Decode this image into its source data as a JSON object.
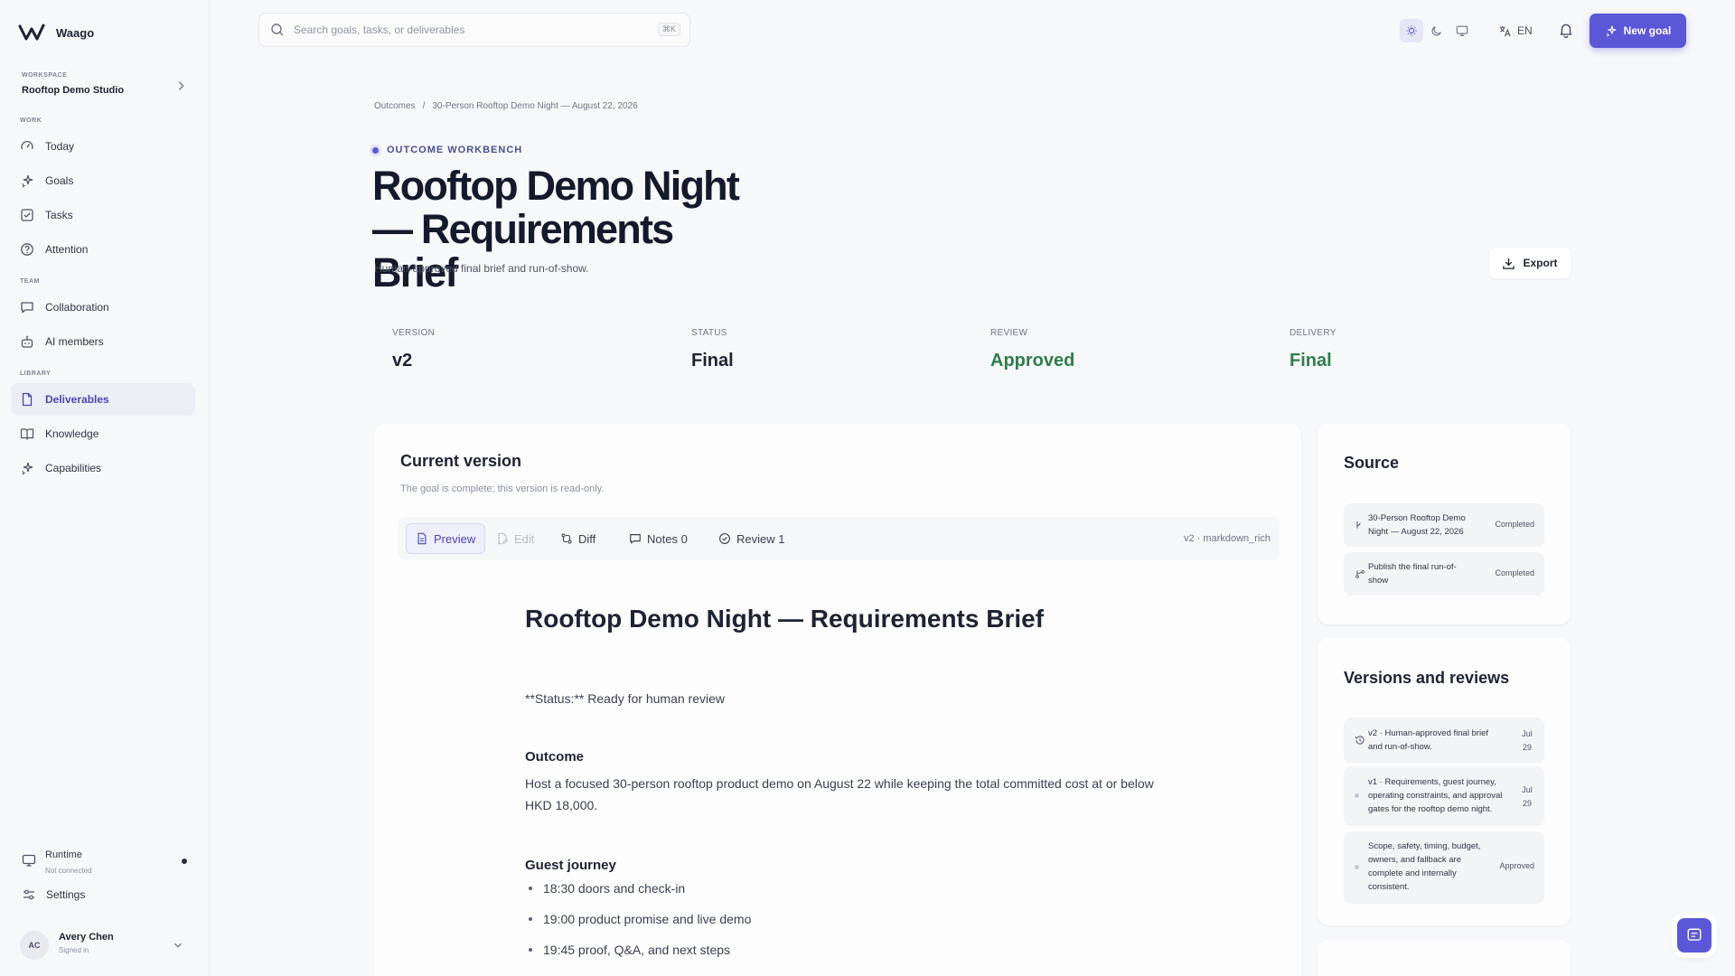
{
  "brand": {
    "name": "Waago"
  },
  "workspace": {
    "label": "WORKSPACE",
    "name": "Rooftop Demo Studio"
  },
  "sidebar": {
    "sections": {
      "work": "WORK",
      "team": "TEAM",
      "library": "LIBRARY"
    },
    "items": [
      {
        "label": "Today",
        "icon": "gauge-icon"
      },
      {
        "label": "Goals",
        "icon": "sparkle-icon"
      },
      {
        "label": "Tasks",
        "icon": "checkbox-icon"
      },
      {
        "label": "Attention",
        "icon": "help-circle-icon"
      },
      {
        "label": "Collaboration",
        "icon": "message-icon"
      },
      {
        "label": "AI members",
        "icon": "bot-icon"
      },
      {
        "label": "Deliverables",
        "icon": "file-icon"
      },
      {
        "label": "Knowledge",
        "icon": "book-icon"
      },
      {
        "label": "Capabilities",
        "icon": "sparkle-icon"
      }
    ],
    "runtime": {
      "title": "Runtime",
      "status": "Not connected"
    },
    "settings": "Settings",
    "user": {
      "initials": "AC",
      "name": "Avery Chen",
      "status": "Signed in"
    }
  },
  "topbar": {
    "search_placeholder": "Search goals, tasks, or deliverables",
    "shortcut": "⌘K",
    "language": "EN",
    "new_goal": "New goal"
  },
  "breadcrumb": {
    "root": "Outcomes",
    "sep": "/",
    "current": "30-Person Rooftop Demo Night — August 22, 2026"
  },
  "header": {
    "eyebrow": "OUTCOME WORKBENCH",
    "title": "Rooftop Demo Night — Requirements Brief",
    "subtitle": "Human-approved final brief and run-of-show.",
    "export": "Export"
  },
  "stats": [
    {
      "label": "VERSION",
      "value": "v2"
    },
    {
      "label": "STATUS",
      "value": "Final"
    },
    {
      "label": "REVIEW",
      "value": "Approved"
    },
    {
      "label": "DELIVERY",
      "value": "Final"
    }
  ],
  "current_version": {
    "title": "Current version",
    "subtitle": "The goal is complete; this version is read-only.",
    "tabs": {
      "preview": "Preview",
      "edit": "Edit",
      "diff": "Diff",
      "notes": "Notes 0",
      "review": "Review 1"
    },
    "meta": "v2 · markdown_rich"
  },
  "document": {
    "title": "Rooftop Demo Night — Requirements Brief",
    "status_line": "**Status:** Ready for human review",
    "outcome_heading": "Outcome",
    "outcome_text": "Host a focused 30-person rooftop product demo on August 22 while keeping the total committed cost at or below HKD 18,000.",
    "journey_heading": "Guest journey",
    "journey": [
      "18:30 doors and check-in",
      "19:00 product promise and live demo",
      "19:45 proof, Q&A, and next steps"
    ]
  },
  "source": {
    "title": "Source",
    "items": [
      {
        "text": "30-Person Rooftop Demo Night — August 22, 2026",
        "status": "Completed"
      },
      {
        "text": "Publish the final run-of-show",
        "status": "Completed"
      }
    ]
  },
  "versions": {
    "title": "Versions and reviews",
    "items": [
      {
        "text": "v2 · Human-approved final brief and run-of-show.",
        "date": "Jul 29"
      },
      {
        "text": "v1 · Requirements, guest journey, operating constraints, and approval gates for the rooftop demo night.",
        "date": "Jul 29"
      },
      {
        "text": "Scope, safety, timing, budget, owners, and fallback are complete and internally consistent.",
        "date": "Approved"
      }
    ]
  },
  "colors": {
    "accent": "#5b57d6",
    "approved": "#2f7d4c"
  }
}
